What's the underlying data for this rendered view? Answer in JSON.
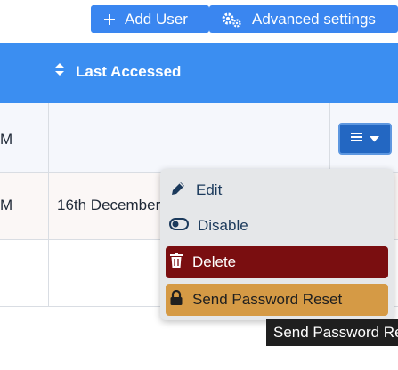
{
  "toolbar": {
    "add_user_label": "Add User",
    "advanced_settings_label": "Advanced settings"
  },
  "table": {
    "column_header": "Last Accessed",
    "rows": [
      {
        "partial_left": "M",
        "last_accessed": ""
      },
      {
        "partial_left": "M",
        "last_accessed": "16th December"
      },
      {
        "partial_left": "",
        "last_accessed": ""
      }
    ]
  },
  "action_menu": {
    "items": [
      {
        "label": "Edit",
        "icon": "pencil-icon"
      },
      {
        "label": "Disable",
        "icon": "toggle-icon"
      },
      {
        "label": "Delete",
        "icon": "trash-icon"
      },
      {
        "label": "Send Password Reset",
        "icon": "lock-icon"
      }
    ]
  },
  "tooltip": {
    "text": "Send Password Reset"
  },
  "colors": {
    "primary": "#3a86f0",
    "header": "#3b8ef1",
    "danger": "#7a0e10",
    "warning": "#d59a45"
  }
}
